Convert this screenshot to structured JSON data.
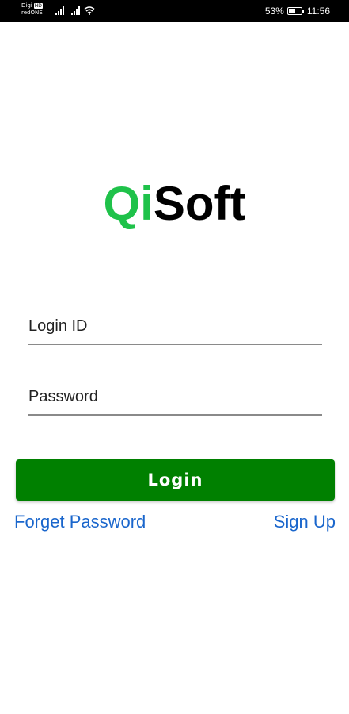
{
  "status_bar": {
    "carrier_line1": "Digi",
    "carrier_hd": "HD",
    "carrier_line2": "redONE",
    "battery_percent": "53%",
    "battery_level": 0.53,
    "time": "11:56",
    "icons": [
      "signal-icon",
      "signal-icon",
      "wifi-icon",
      "battery-icon"
    ]
  },
  "logo": {
    "part1": "Qi",
    "part2": "Soft",
    "part1_color": "#1fc24a",
    "part2_color": "#000000"
  },
  "form": {
    "login_id_placeholder": "Login ID",
    "login_id_value": "",
    "password_placeholder": "Password",
    "password_value": "",
    "login_button_label": "Login",
    "login_button_color": "#008000"
  },
  "links": {
    "forget_password": "Forget Password",
    "sign_up": "Sign Up",
    "link_color": "#1a66cc"
  }
}
